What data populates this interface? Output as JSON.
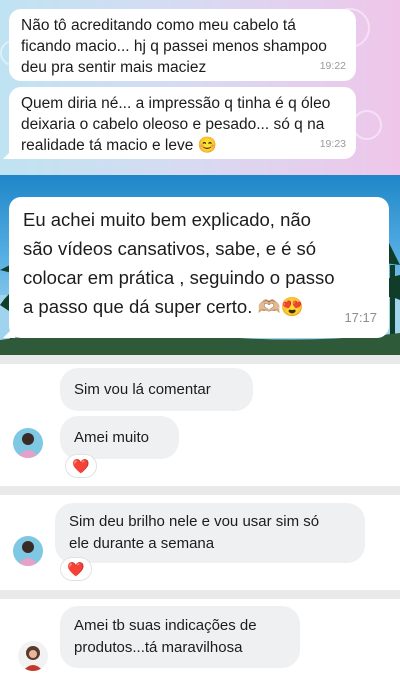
{
  "whatsapp_thread_1": {
    "messages": [
      {
        "text_lines": [
          "Não tô acreditando como meu cabelo tá",
          "ficando macio... hj q passei menos shampoo",
          "deu pra sentir mais maciez"
        ],
        "time": "19:22"
      },
      {
        "text_lines": [
          "Quem diria né... a impressão q tinha é q óleo",
          "deixaria o cabelo oleoso e pesado... só q na",
          "realidade tá macio e leve"
        ],
        "emoji": "😊",
        "time": "19:23"
      }
    ]
  },
  "whatsapp_thread_2": {
    "message": {
      "text_lines": [
        "Eu achei muito bem explicado, não",
        "são vídeos cansativos, sabe, e é  só",
        "colocar em prática , seguindo o passo",
        "a passo que dá super certo."
      ],
      "emojis": "🫶🏼😍",
      "time": "17:17"
    }
  },
  "comments": {
    "comment_1": {
      "replies": [
        "Sim vou lá comentar",
        "Amei muito"
      ],
      "reaction": "❤️"
    },
    "comment_2": {
      "text_lines": [
        "Sim deu brilho nele e vou usar sim só",
        "ele durante a semana"
      ],
      "reaction": "❤️"
    },
    "comment_3": {
      "text_lines": [
        "Amei tb suas indicações de",
        "produtos...tá maravilhosa"
      ]
    }
  },
  "colors": {
    "bubble": "#ffffff",
    "comment_bubble": "#eef0f2",
    "divider": "#e9e9ea",
    "heart": "#e0245e"
  }
}
